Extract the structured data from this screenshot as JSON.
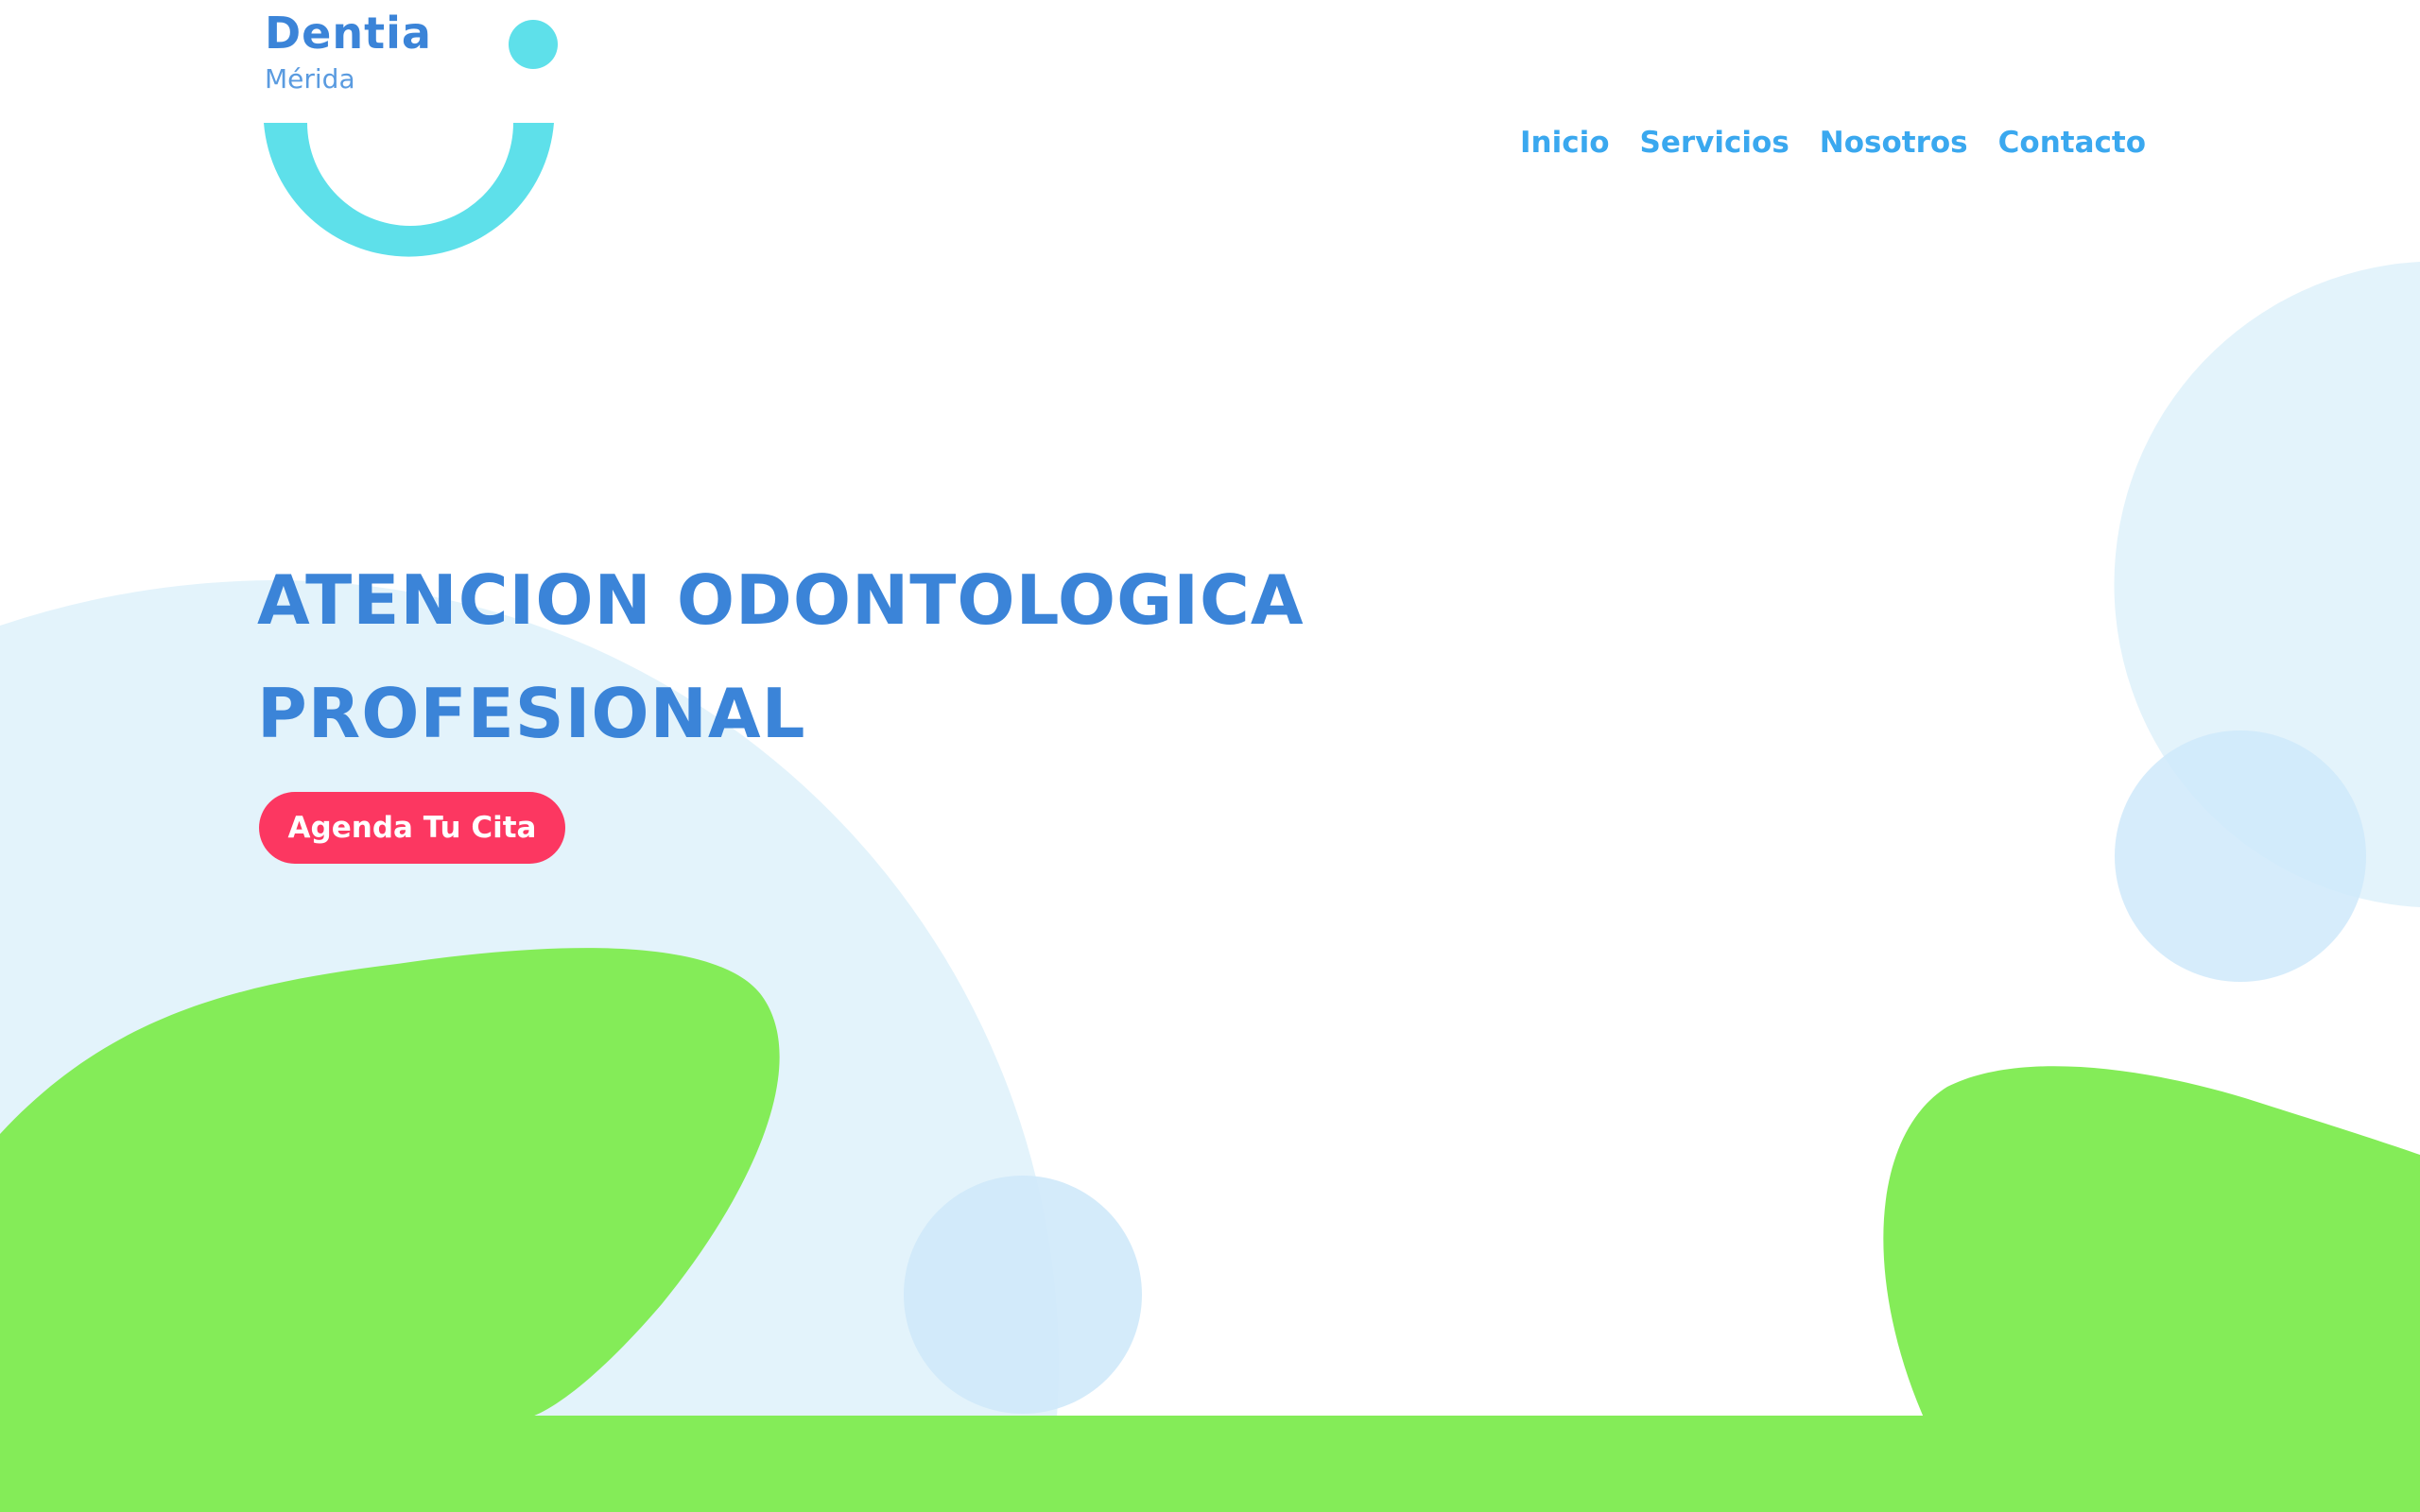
{
  "brand": {
    "name": "Dentia",
    "city": "Mérida"
  },
  "nav": {
    "items": [
      {
        "label": "Inicio"
      },
      {
        "label": "Servicios"
      },
      {
        "label": "Nosotros"
      },
      {
        "label": "Contacto"
      }
    ]
  },
  "hero": {
    "title_line1": "ATENCION ODONTOLOGICA",
    "title_line2": "PROFESIONAL",
    "cta_label": "Agenda Tu Cita"
  },
  "colors": {
    "brand_blue": "#3b84d8",
    "nav_blue": "#3aa8ef",
    "logo_cyan": "#5ee0ea",
    "cta_red": "#fc3761",
    "blob_green": "#84ec58",
    "bubble_blue": "#e3f3fb"
  }
}
